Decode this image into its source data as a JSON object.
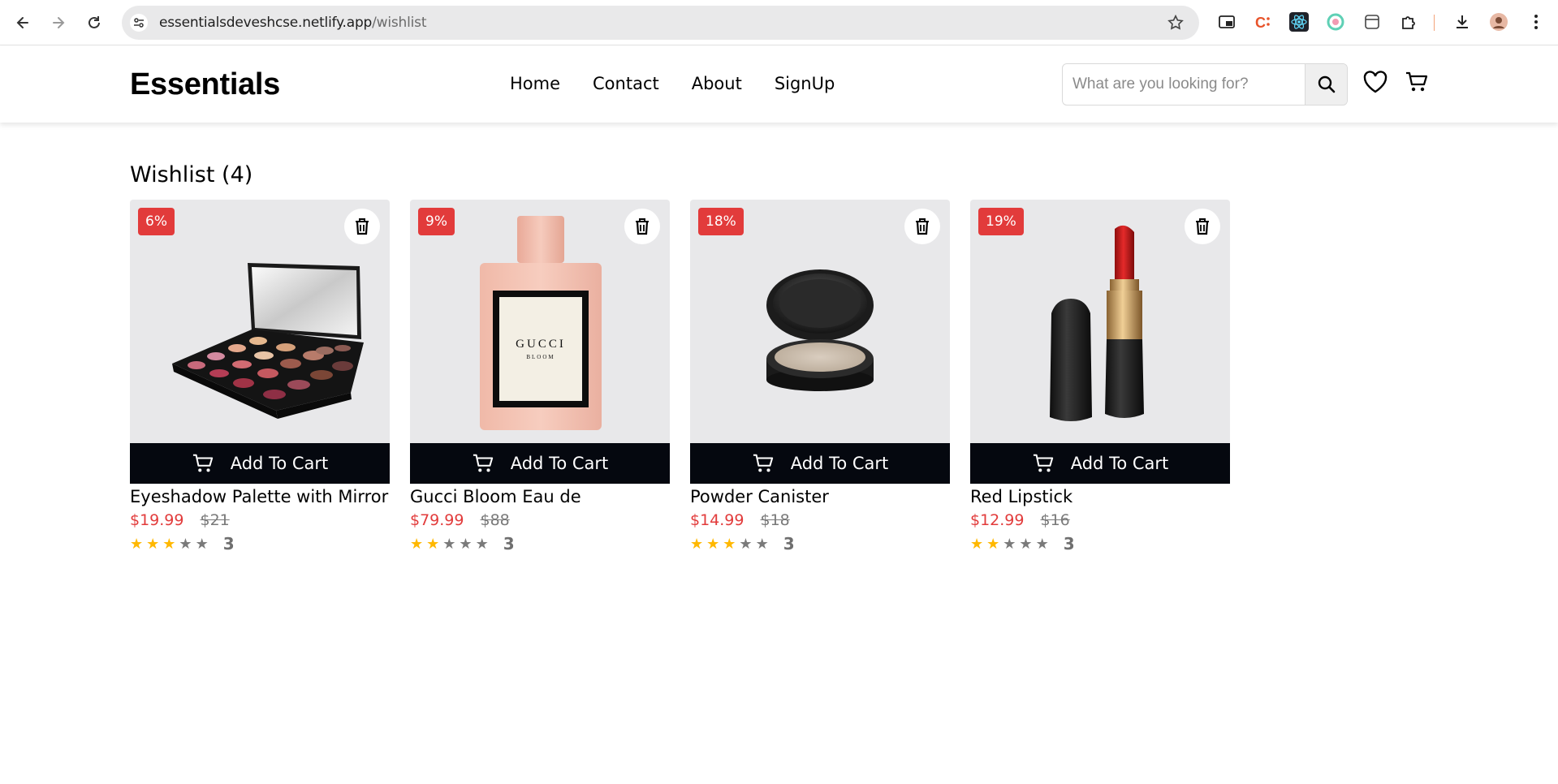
{
  "browser": {
    "url_host": "essentialsdeveshcse.netlify.app",
    "url_path": "/wishlist",
    "icons": [
      "back-arrow-icon",
      "forward-arrow-icon",
      "reload-icon",
      "site-info-icon",
      "bookmark-star-icon",
      "picture-in-picture-icon",
      "extension-c-icon",
      "react-devtools-icon",
      "color-extension-icon",
      "tab-icon",
      "puzzle-extensions-icon",
      "download-icon",
      "profile-avatar-icon",
      "kebab-menu-icon"
    ]
  },
  "header": {
    "logo": "Essentials",
    "nav": [
      "Home",
      "Contact",
      "About",
      "SignUp"
    ],
    "search_placeholder": "What are you looking for?"
  },
  "wishlist": {
    "title": "Wishlist",
    "count_text": "(4)",
    "add_to_cart_label": "Add To Cart",
    "items": [
      {
        "discount": "6%",
        "name": "Eyeshadow Palette with Mirror",
        "price": "$19.99",
        "old_price": "$21",
        "rating": 3,
        "rating_count": "3",
        "image": "eyeshadow-palette"
      },
      {
        "discount": "9%",
        "name": "Gucci Bloom Eau de",
        "price": "$79.99",
        "old_price": "$88",
        "rating": 2,
        "rating_count": "3",
        "image": "perfume-bottle"
      },
      {
        "discount": "18%",
        "name": "Powder Canister",
        "price": "$14.99",
        "old_price": "$18",
        "rating": 3,
        "rating_count": "3",
        "image": "powder-compact"
      },
      {
        "discount": "19%",
        "name": "Red Lipstick",
        "price": "$12.99",
        "old_price": "$16",
        "rating": 2,
        "rating_count": "3",
        "image": "red-lipstick"
      }
    ],
    "perfume_label_brand": "GUCCI",
    "perfume_label_sub": "BLOOM"
  },
  "colors": {
    "accent_red": "#e23b3b",
    "button_dark": "#05080f",
    "star_gold": "#ffb800",
    "card_bg": "#e8e8ea"
  }
}
